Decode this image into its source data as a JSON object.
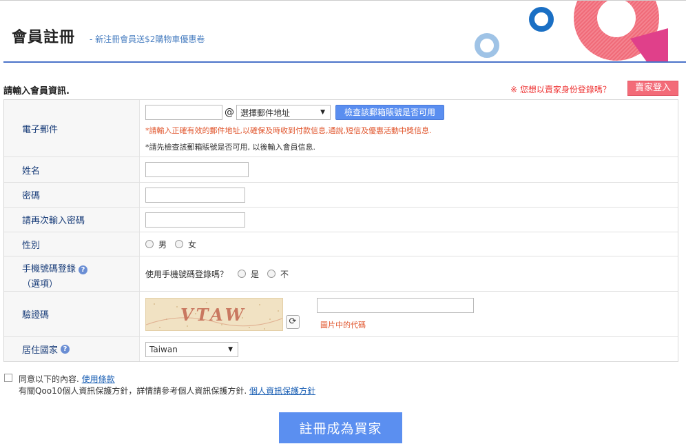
{
  "header": {
    "title": "會員註冊",
    "subtitle": "- 新注冊會員送$2購物車優惠卷"
  },
  "section": {
    "title": "請輸入會員資訊.",
    "seller_prompt": "※ 您想以賣家身份登錄嗎？",
    "seller_login_label": "賣家登入"
  },
  "form": {
    "email": {
      "label": "電子郵件",
      "at_sign": "@",
      "local_value": "",
      "domain_select": "選擇郵件地址",
      "check_button": "檢查該郵箱賬號是否可用",
      "notice_red": "*請輸入正確有效的郵件地址,以確保及時收到付款信息,通說,短信及優惠活動中獎信息.",
      "notice_gray": "*請先檢查該郵箱賬號是否可用, 以後輸入會員信息."
    },
    "name": {
      "label": "姓名",
      "value": ""
    },
    "password": {
      "label": "密碼",
      "value": ""
    },
    "password_confirm": {
      "label": "請再次輸入密碼",
      "value": ""
    },
    "gender": {
      "label": "性別",
      "male": "男",
      "female": "女"
    },
    "phone_login": {
      "label_line1": "手機號碼登錄",
      "label_line2": "（選項）",
      "question": "使用手機號碼登錄嗎？",
      "yes": "是",
      "no": "不"
    },
    "captcha": {
      "label": "驗證碼",
      "image_text": "VTAW",
      "value": "",
      "hint": "圖片中的代碼"
    },
    "country": {
      "label": "居住國家",
      "selected": "Taiwan"
    }
  },
  "agreement": {
    "line1_text": "同意以下的內容.",
    "terms_link": "使用條款",
    "line2_text": "有關Qoo10個人資訊保護方針，詳情請參考個人資訊保護方針.",
    "privacy_link": "個人資訊保護方針"
  },
  "submit_label": "註冊成為買家",
  "colors": {
    "accent_blue": "#5b8ff0",
    "header_rule": "#4a72c9",
    "seller_button": "#f36b78",
    "warning_red": "#e33"
  }
}
